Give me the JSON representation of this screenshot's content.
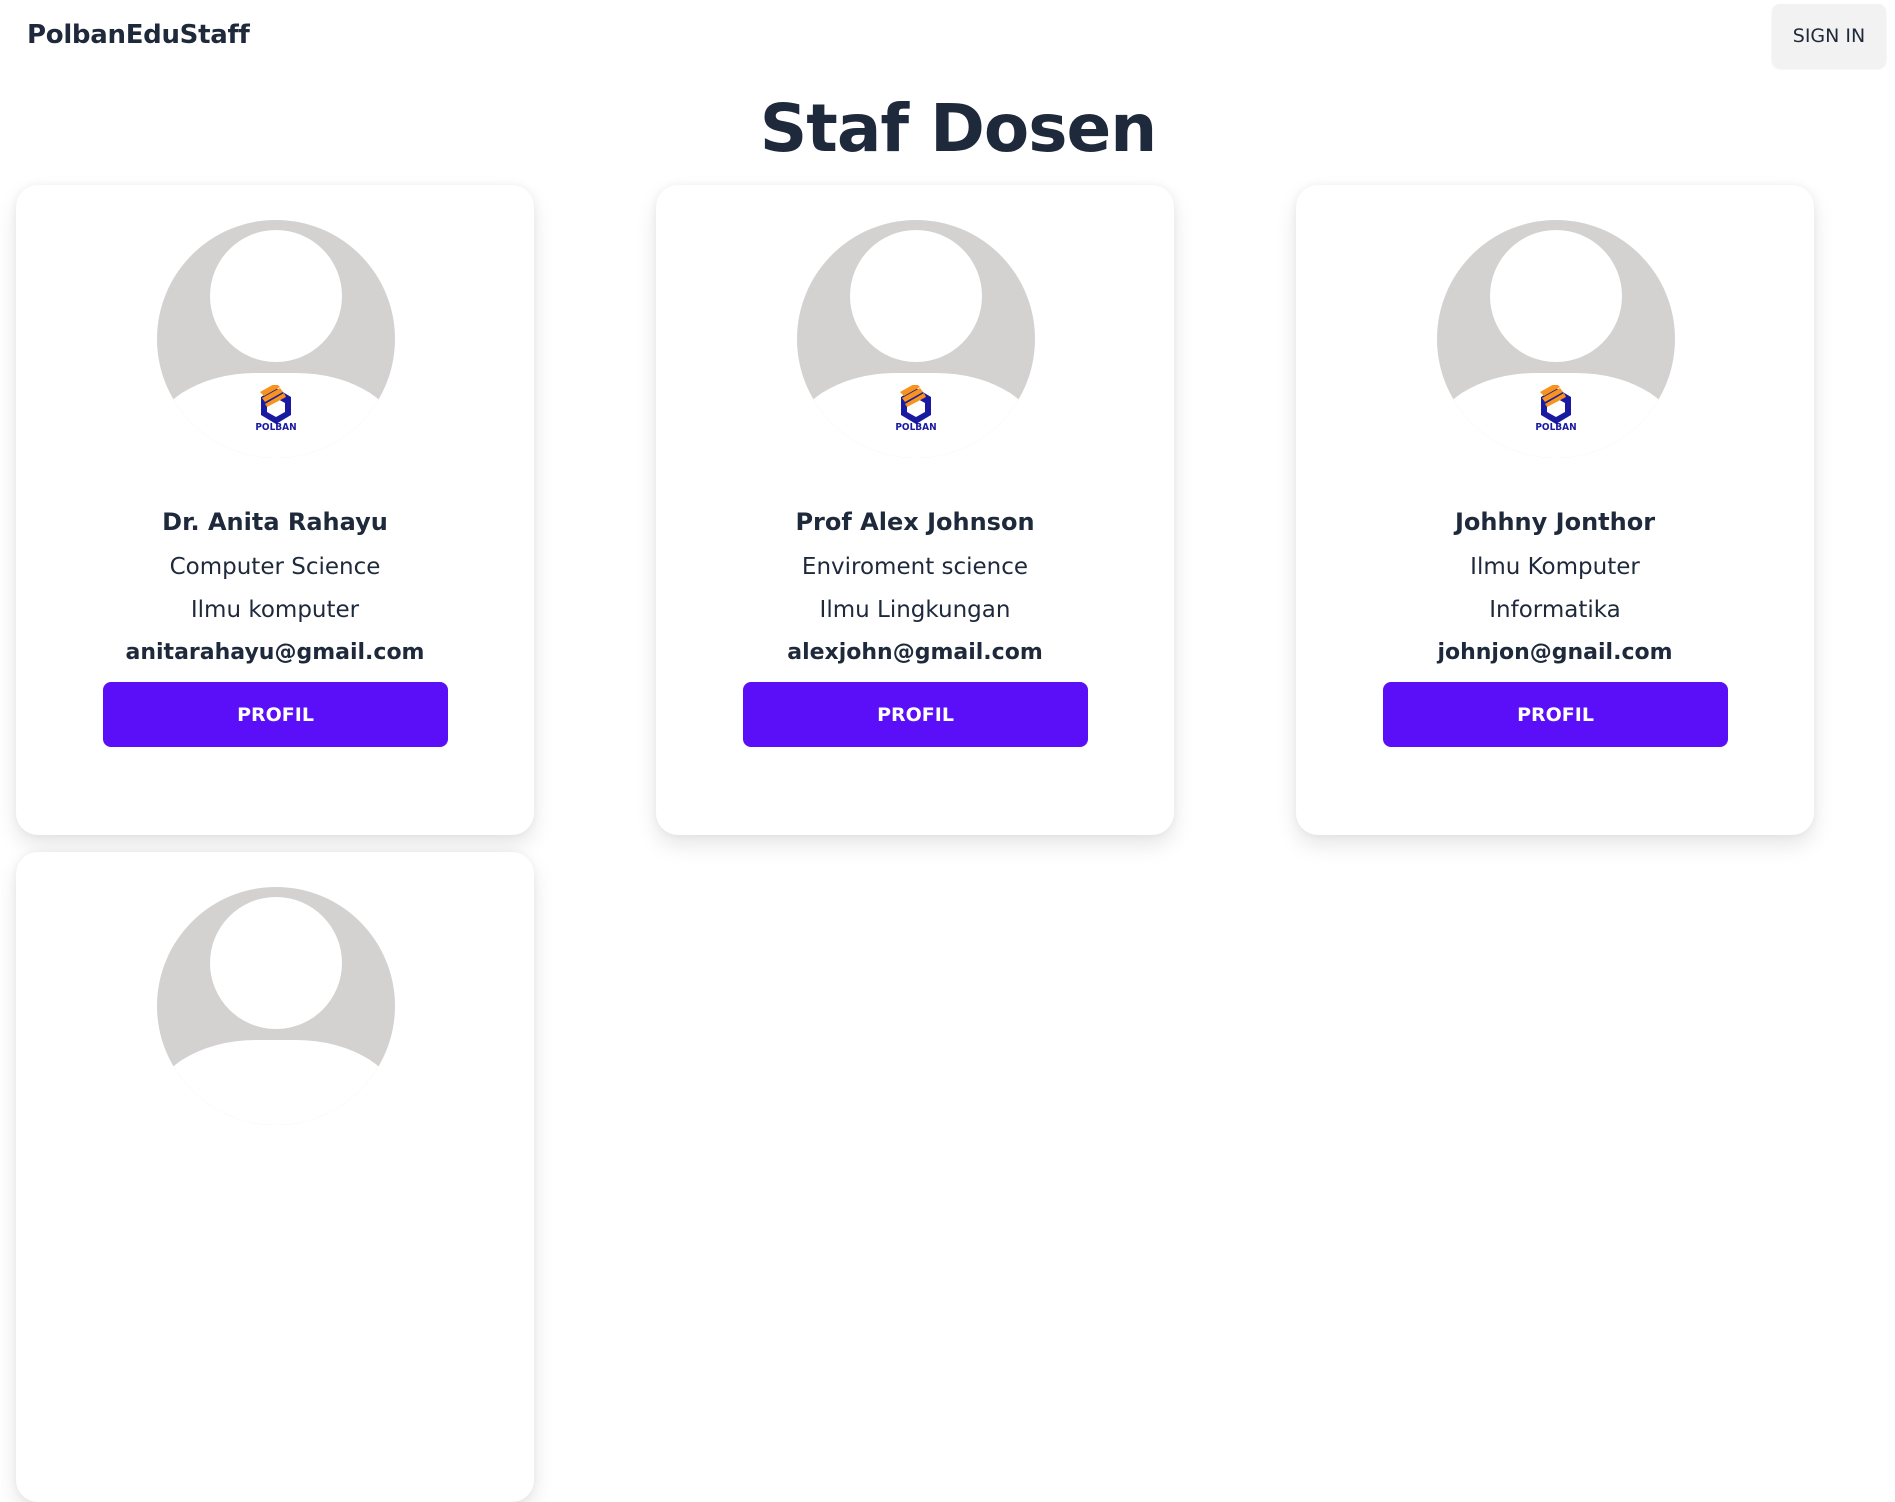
{
  "navbar": {
    "brand": "PolbanEduStaff",
    "signin_label": "SIGN IN"
  },
  "page": {
    "title": "Staf Dosen"
  },
  "logo_text": "POLBAN",
  "colors": {
    "accent": "#5b0ef8",
    "text": "#1e293b",
    "avatar_bg": "#d4d1d1"
  },
  "staff": [
    {
      "name": "Dr. Anita Rahayu",
      "department": "Computer Science",
      "major": "Ilmu komputer",
      "email": "anitarahayu@gmail.com",
      "button_label": "PROFIL"
    },
    {
      "name": "Prof Alex Johnson",
      "department": "Enviroment science",
      "major": "Ilmu Lingkungan",
      "email": "alexjohn@gmail.com",
      "button_label": "PROFIL"
    },
    {
      "name": "Johhny Jonthor",
      "department": "Ilmu Komputer",
      "major": "Informatika",
      "email": "johnjon@gnail.com",
      "button_label": "PROFIL"
    }
  ]
}
